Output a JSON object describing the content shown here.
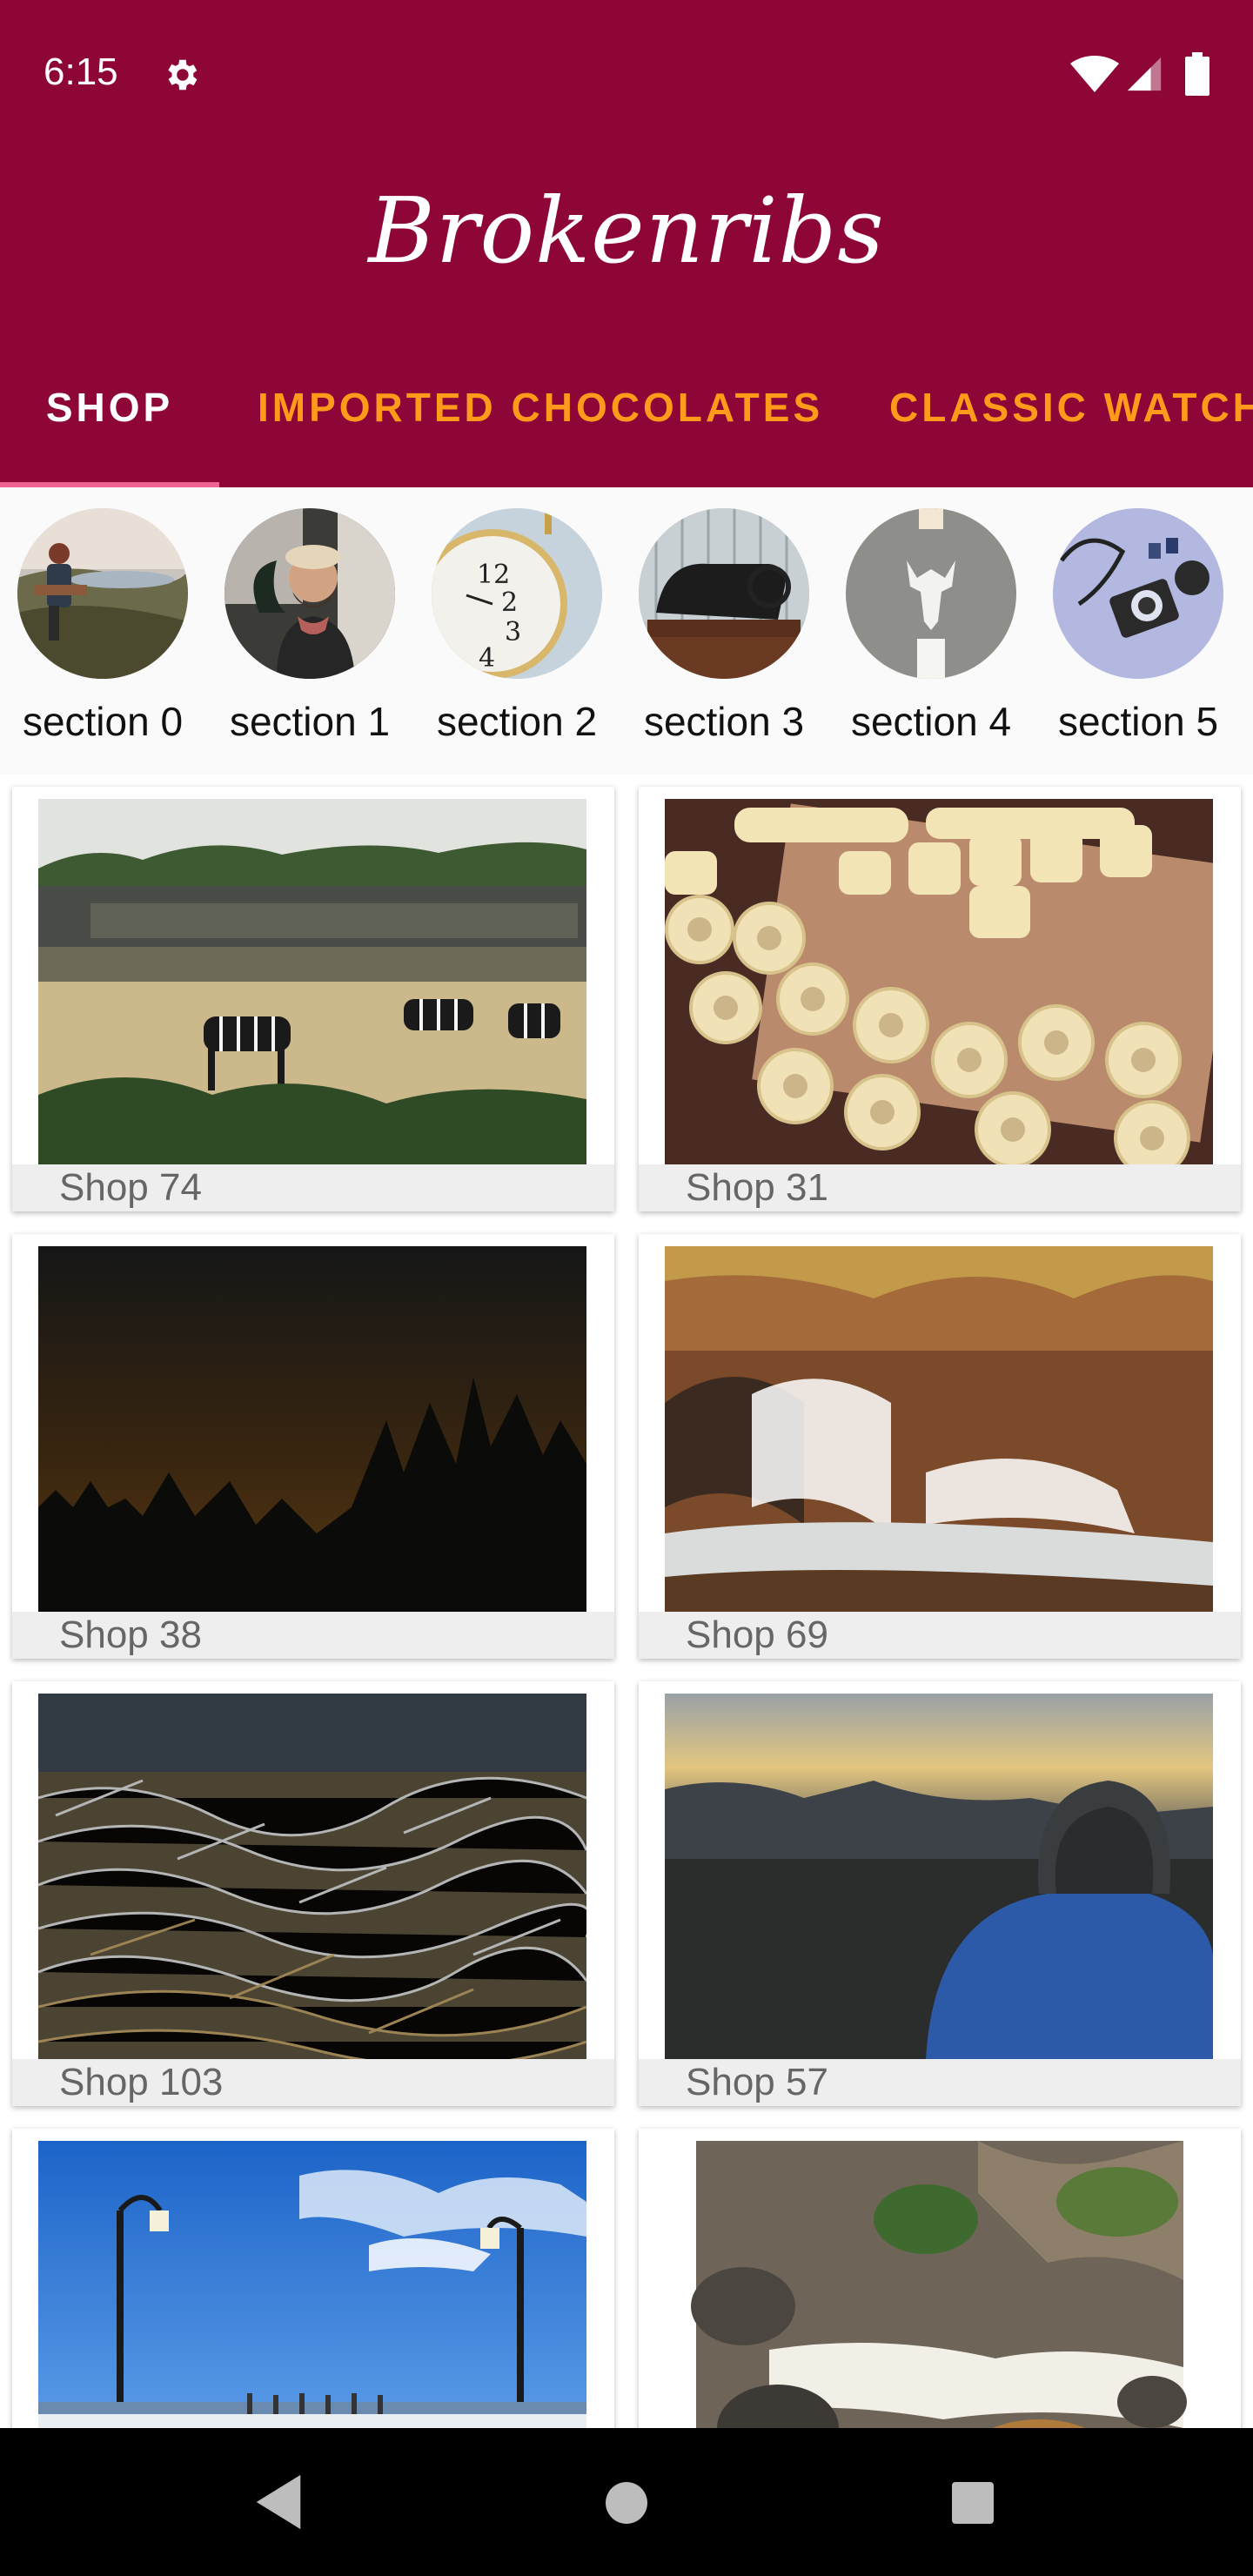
{
  "status_bar": {
    "time": "6:15",
    "icons": [
      "gear-icon",
      "wifi-icon",
      "signal-icon",
      "battery-icon"
    ]
  },
  "app_bar": {
    "title": "Brokenribs",
    "background_color": "#8e0538",
    "tabs": [
      {
        "label": "SHOP",
        "selected": true
      },
      {
        "label": "IMPORTED CHOCOLATES",
        "selected": false
      },
      {
        "label": "CLASSIC WATCH",
        "selected": false
      }
    ],
    "selected_tab_color": "#ffffff",
    "unselected_tab_color": "#ff9a1a",
    "indicator_color": "#f06292"
  },
  "sections": [
    {
      "label": "section 0",
      "image": "guitar-player-photo"
    },
    {
      "label": "section 1",
      "image": "bearded-man-photo"
    },
    {
      "label": "section 2",
      "image": "pocket-watch-photo"
    },
    {
      "label": "section 3",
      "image": "sewing-machine-photo"
    },
    {
      "label": "section 4",
      "image": "deer-head-decor-photo"
    },
    {
      "label": "section 5",
      "image": "camera-gear-photo"
    }
  ],
  "shops": [
    {
      "label": "Shop 74",
      "image": "zebras-photo"
    },
    {
      "label": "Shop 31",
      "image": "gnocchi-photo"
    },
    {
      "label": "Shop 38",
      "image": "night-sky-trees-photo"
    },
    {
      "label": "Shop 69",
      "image": "waterfall-photo"
    },
    {
      "label": "Shop 103",
      "image": "dry-grass-photo"
    },
    {
      "label": "Shop 57",
      "image": "hiker-mountains-photo"
    },
    {
      "label": "",
      "image": "pier-lamps-photo"
    },
    {
      "label": "",
      "image": "rocky-stream-photo"
    }
  ],
  "nav_bar": {
    "icons": [
      "back-icon",
      "home-icon",
      "recent-apps-icon"
    ]
  }
}
